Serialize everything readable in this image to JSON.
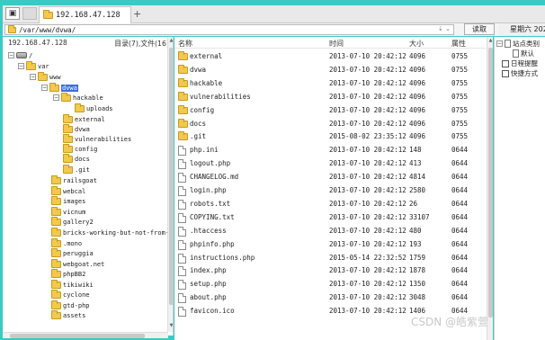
{
  "tabs": [
    {
      "label": "192.168.47.128"
    }
  ],
  "address": {
    "path": "/var/www/dvwa/",
    "read_label": "读取",
    "weekday": "星期六 202"
  },
  "left_panel": {
    "host": "192.168.47.128",
    "summary": "目录(7),文件(16)",
    "tree": [
      {
        "label": "/"
      },
      {
        "label": "var"
      },
      {
        "label": "www"
      },
      {
        "label": "dvwa"
      },
      {
        "label": "hackable"
      },
      {
        "label": "uploads"
      },
      {
        "label": "external"
      },
      {
        "label": "dvwa"
      },
      {
        "label": "vulnerabilities"
      },
      {
        "label": "config"
      },
      {
        "label": "docs"
      },
      {
        "label": ".git"
      },
      {
        "label": "railsgoat"
      },
      {
        "label": "webcal"
      },
      {
        "label": "images"
      },
      {
        "label": "vicnum"
      },
      {
        "label": "gallery2"
      },
      {
        "label": "bricks-working-but-not-from-"
      },
      {
        "label": ".mono"
      },
      {
        "label": "peruggia"
      },
      {
        "label": "webgoat.net"
      },
      {
        "label": "phpBB2"
      },
      {
        "label": "tikiwiki"
      },
      {
        "label": "cyclone"
      },
      {
        "label": "gtd-php"
      },
      {
        "label": "assets"
      }
    ]
  },
  "file_list": {
    "headers": {
      "name": "名称",
      "time": "时间",
      "size": "大小",
      "attr": "属性"
    },
    "rows": [
      {
        "name": "external",
        "time": "2013-07-10 20:42:12",
        "size": "4096",
        "attr": "0755",
        "type": "folder"
      },
      {
        "name": "dvwa",
        "time": "2013-07-10 20:42:12",
        "size": "4096",
        "attr": "0755",
        "type": "folder"
      },
      {
        "name": "hackable",
        "time": "2013-07-10 20:42:12",
        "size": "4096",
        "attr": "0755",
        "type": "folder"
      },
      {
        "name": "vulnerabilities",
        "time": "2013-07-10 20:42:12",
        "size": "4096",
        "attr": "0755",
        "type": "folder"
      },
      {
        "name": "config",
        "time": "2013-07-10 20:42:12",
        "size": "4096",
        "attr": "0755",
        "type": "folder"
      },
      {
        "name": "docs",
        "time": "2013-07-10 20:42:12",
        "size": "4096",
        "attr": "0755",
        "type": "folder"
      },
      {
        "name": ".git",
        "time": "2015-08-02 23:35:12",
        "size": "4096",
        "attr": "0755",
        "type": "folder"
      },
      {
        "name": "php.ini",
        "time": "2013-07-10 20:42:12",
        "size": "148",
        "attr": "0644",
        "type": "file"
      },
      {
        "name": "logout.php",
        "time": "2013-07-10 20:42:12",
        "size": "413",
        "attr": "0644",
        "type": "file"
      },
      {
        "name": "CHANGELOG.md",
        "time": "2013-07-10 20:42:12",
        "size": "4814",
        "attr": "0644",
        "type": "file"
      },
      {
        "name": "login.php",
        "time": "2013-07-10 20:42:12",
        "size": "2580",
        "attr": "0644",
        "type": "file"
      },
      {
        "name": "robots.txt",
        "time": "2013-07-10 20:42:12",
        "size": "26",
        "attr": "0644",
        "type": "file"
      },
      {
        "name": "COPYING.txt",
        "time": "2013-07-10 20:42:12",
        "size": "33107",
        "attr": "0644",
        "type": "file"
      },
      {
        "name": ".htaccess",
        "time": "2013-07-10 20:42:12",
        "size": "480",
        "attr": "0644",
        "type": "file"
      },
      {
        "name": "phpinfo.php",
        "time": "2013-07-10 20:42:12",
        "size": "193",
        "attr": "0644",
        "type": "file"
      },
      {
        "name": "instructions.php",
        "time": "2015-05-14 22:32:52",
        "size": "1759",
        "attr": "0644",
        "type": "file"
      },
      {
        "name": "index.php",
        "time": "2013-07-10 20:42:12",
        "size": "1878",
        "attr": "0644",
        "type": "file"
      },
      {
        "name": "setup.php",
        "time": "2013-07-10 20:42:12",
        "size": "1350",
        "attr": "0644",
        "type": "file"
      },
      {
        "name": "about.php",
        "time": "2013-07-10 20:42:12",
        "size": "3048",
        "attr": "0644",
        "type": "file"
      },
      {
        "name": "favicon.ico",
        "time": "2013-07-10 20:42:12",
        "size": "1406",
        "attr": "0644",
        "type": "file"
      }
    ]
  },
  "right_panel": {
    "items": [
      {
        "label": "站点类别"
      },
      {
        "label": "默认"
      },
      {
        "label": "日程提醒"
      },
      {
        "label": "快捷方式"
      }
    ]
  },
  "watermark": "CSDN @皓紫萱"
}
